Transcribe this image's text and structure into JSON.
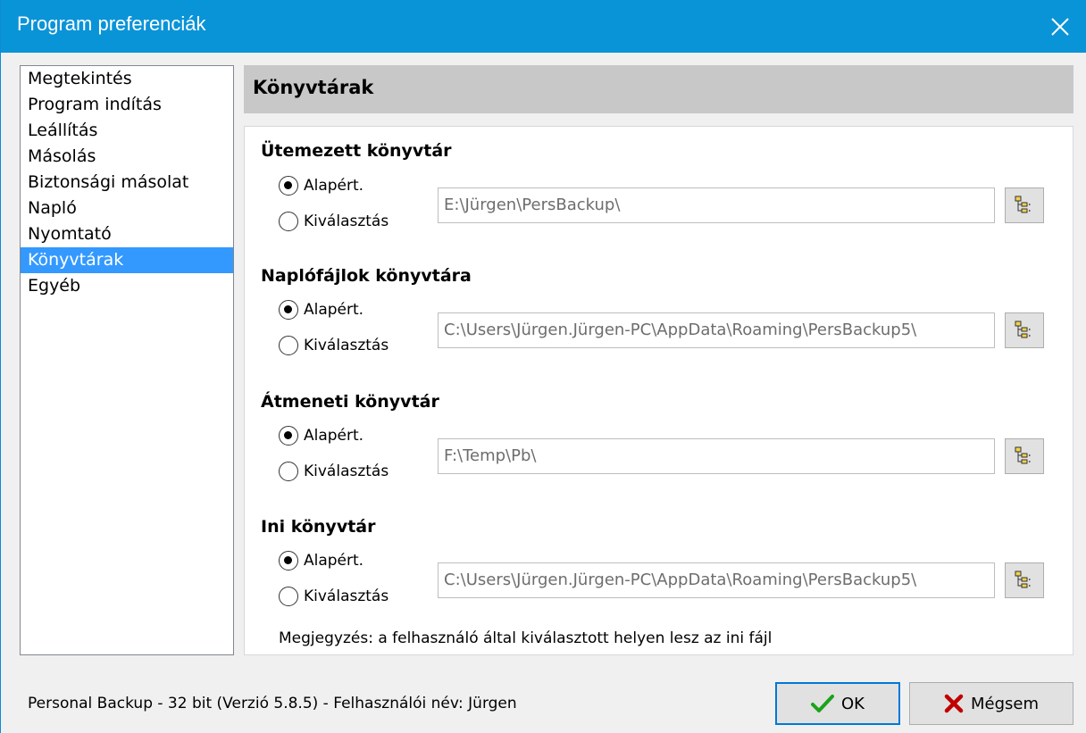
{
  "window": {
    "title": "Program preferenciák"
  },
  "sidebar": {
    "items": [
      {
        "label": "Megtekintés"
      },
      {
        "label": "Program indítás"
      },
      {
        "label": "Leállítás"
      },
      {
        "label": "Másolás"
      },
      {
        "label": "Biztonsági másolat"
      },
      {
        "label": "Napló"
      },
      {
        "label": "Nyomtató"
      },
      {
        "label": "Könyvtárak",
        "selected": true
      },
      {
        "label": "Egyéb"
      }
    ]
  },
  "panel": {
    "title": "Könyvtárak",
    "sections": [
      {
        "title": "Ütemezett könyvtár",
        "option_default": "Alapért.",
        "option_select": "Kiválasztás",
        "selected_option": "default",
        "path": "E:\\Jürgen\\PersBackup\\"
      },
      {
        "title": "Naplófájlok könyvtára",
        "option_default": "Alapért.",
        "option_select": "Kiválasztás",
        "selected_option": "default",
        "path": "C:\\Users\\Jürgen.Jürgen-PC\\AppData\\Roaming\\PersBackup5\\"
      },
      {
        "title": "Átmeneti könyvtár",
        "option_default": "Alapért.",
        "option_select": "Kiválasztás",
        "selected_option": "default",
        "path": "F:\\Temp\\Pb\\"
      },
      {
        "title": "Ini könyvtár",
        "option_default": "Alapért.",
        "option_select": "Kiválasztás",
        "selected_option": "default",
        "path": "C:\\Users\\Jürgen.Jürgen-PC\\AppData\\Roaming\\PersBackup5\\"
      }
    ],
    "note": "Megjegyzés: a felhasználó által kiválasztott helyen lesz az ini fájl"
  },
  "status": {
    "text": "Personal Backup - 32 bit (Verzió 5.8.5) - Felhasználói név: Jürgen"
  },
  "buttons": {
    "ok_label": "OK",
    "cancel_label": "Mégsem"
  },
  "colors": {
    "titlebar": "#0a94d8",
    "selection": "#3399ff",
    "ok_check": "#1aa31a",
    "cancel_x": "#c00000"
  },
  "icons": {
    "close": "close-icon",
    "browse": "folder-tree-icon",
    "ok": "checkmark-icon",
    "cancel": "x-icon"
  }
}
